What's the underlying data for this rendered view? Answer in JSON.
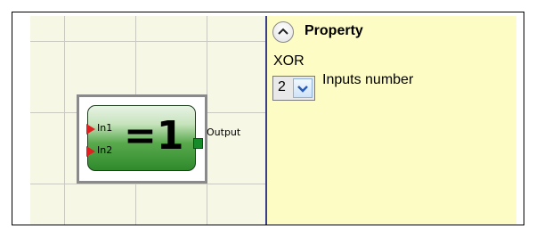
{
  "block": {
    "symbol": "=1",
    "inputs": [
      "In1",
      "In2"
    ],
    "output_label": "Output"
  },
  "property_panel": {
    "title": "Property",
    "collapse_icon": "chevron-up-icon",
    "component_name": "XOR",
    "inputs_number": {
      "value": "2",
      "label": "Inputs number",
      "icon": "chevron-down-icon"
    }
  },
  "colors": {
    "canvas_bg": "#f7f7e6",
    "panel_bg": "#fdfcc4",
    "input_pin": "#e02020",
    "output_pin": "#178a2a",
    "divider": "#3a3f8a"
  }
}
